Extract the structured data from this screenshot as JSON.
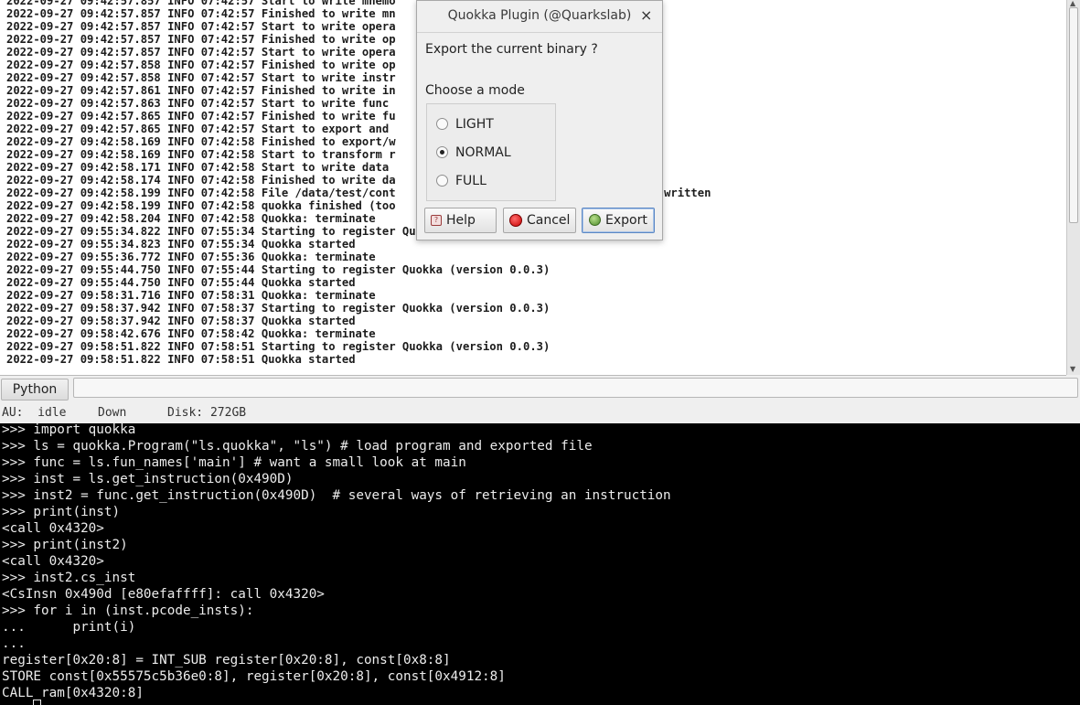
{
  "log": {
    "lines": [
      "2022-09-27 09:42:57.857 INFO 07:42:57 Start to write mnemo",
      "2022-09-27 09:42:57.857 INFO 07:42:57 Finished to write mn",
      "2022-09-27 09:42:57.857 INFO 07:42:57 Start to write opera",
      "2022-09-27 09:42:57.857 INFO 07:42:57 Finished to write op",
      "2022-09-27 09:42:57.857 INFO 07:42:57 Start to write opera",
      "2022-09-27 09:42:57.858 INFO 07:42:57 Finished to write op",
      "2022-09-27 09:42:57.858 INFO 07:42:57 Start to write instr",
      "2022-09-27 09:42:57.861 INFO 07:42:57 Finished to write in",
      "2022-09-27 09:42:57.863 INFO 07:42:57 Start to write func",
      "2022-09-27 09:42:57.865 INFO 07:42:57 Finished to write fu",
      "2022-09-27 09:42:57.865 INFO 07:42:57 Start to export and",
      "2022-09-27 09:42:58.169 INFO 07:42:58 Finished to export/w",
      "2022-09-27 09:42:58.169 INFO 07:42:58 Start to transform r",
      "2022-09-27 09:42:58.171 INFO 07:42:58 Start to write data",
      "2022-09-27 09:42:58.174 INFO 07:42:58 Finished to write da                      0.00s)",
      "2022-09-27 09:42:58.199 INFO 07:42:58 File /data/test/cont                     okka/ls2.quokka is written",
      "2022-09-27 09:42:58.199 INFO 07:42:58 quokka finished (too",
      "2022-09-27 09:42:58.204 INFO 07:42:58 Quokka: terminate",
      "2022-09-27 09:55:34.822 INFO 07:55:34 Starting to register Quokka (version 0.0.3)",
      "2022-09-27 09:55:34.823 INFO 07:55:34 Quokka started",
      "2022-09-27 09:55:36.772 INFO 07:55:36 Quokka: terminate",
      "2022-09-27 09:55:44.750 INFO 07:55:44 Starting to register Quokka (version 0.0.3)",
      "2022-09-27 09:55:44.750 INFO 07:55:44 Quokka started",
      "2022-09-27 09:58:31.716 INFO 07:58:31 Quokka: terminate",
      "2022-09-27 09:58:37.942 INFO 07:58:37 Starting to register Quokka (version 0.0.3)",
      "2022-09-27 09:58:37.942 INFO 07:58:37 Quokka started",
      "2022-09-27 09:58:42.676 INFO 07:58:42 Quokka: terminate",
      "2022-09-27 09:58:51.822 INFO 07:58:51 Starting to register Quokka (version 0.0.3)",
      "2022-09-27 09:58:51.822 INFO 07:58:51 Quokka started"
    ]
  },
  "cli": {
    "language_button": "Python",
    "input_value": ""
  },
  "status": {
    "au": "AU:  idle",
    "direction": "Down",
    "disk": "Disk: 272GB"
  },
  "console": {
    "lines": [
      ">>> import quokka",
      ">>> ls = quokka.Program(\"ls.quokka\", \"ls\") # load program and exported file",
      ">>> func = ls.fun_names['main'] # want a small look at main",
      ">>> inst = ls.get_instruction(0x490D)",
      ">>> inst2 = func.get_instruction(0x490D)  # several ways of retrieving an instruction",
      ">>> print(inst)",
      "<call 0x4320>",
      ">>> print(inst2)",
      "<call 0x4320>",
      ">>> inst2.cs_inst",
      "<CsInsn 0x490d [e80efaffff]: call 0x4320>",
      ">>> for i in (inst.pcode_insts):",
      "...      print(i)",
      "...",
      "register[0x20:8] = INT_SUB register[0x20:8], const[0x8:8]",
      "STORE const[0x55575c5b36e0:8], register[0x20:8], const[0x4912:8]",
      "CALL ram[0x4320:8]"
    ]
  },
  "dialog": {
    "title": "Quokka Plugin (@Quarkslab)",
    "close_glyph": "×",
    "question": "Export the current binary ?",
    "mode_label": "Choose a mode",
    "modes": [
      {
        "label": "LIGHT",
        "checked": false
      },
      {
        "label": "NORMAL",
        "checked": true
      },
      {
        "label": "FULL",
        "checked": false
      }
    ],
    "help_label": "Help",
    "cancel_label": "Cancel",
    "export_label": "Export",
    "help_icon": "help-icon",
    "cancel_icon": "cancel-icon",
    "export_icon": "export-icon"
  }
}
